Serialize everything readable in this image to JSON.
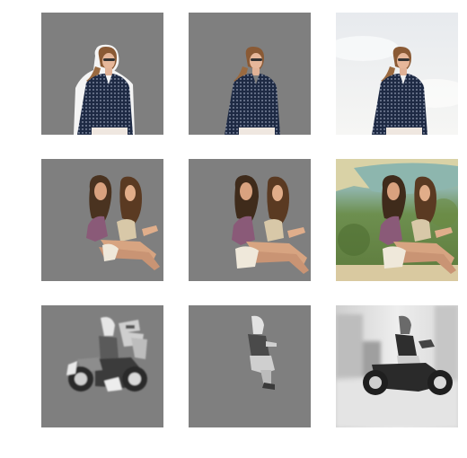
{
  "figure": {
    "rows": [
      {
        "subject": "woman-portrait",
        "tiles": [
          {
            "kind": "mask-result-a",
            "background_color": "#7f7f7f"
          },
          {
            "kind": "mask-result-b",
            "background_color": "#7f7f7f"
          },
          {
            "kind": "original-photo",
            "background_color": "#eef0f3"
          }
        ]
      },
      {
        "subject": "two-women-sitting",
        "tiles": [
          {
            "kind": "mask-result-a",
            "background_color": "#7f7f7f"
          },
          {
            "kind": "mask-result-b",
            "background_color": "#7f7f7f"
          },
          {
            "kind": "original-photo",
            "background_color": "#6f8f5a"
          }
        ]
      },
      {
        "subject": "motorcycle-rider",
        "tiles": [
          {
            "kind": "mask-result-a",
            "background_color": "#7f7f7f"
          },
          {
            "kind": "mask-result-b",
            "background_color": "#7f7f7f"
          },
          {
            "kind": "original-photo",
            "background_color": "#d8d8d8"
          }
        ]
      }
    ]
  }
}
